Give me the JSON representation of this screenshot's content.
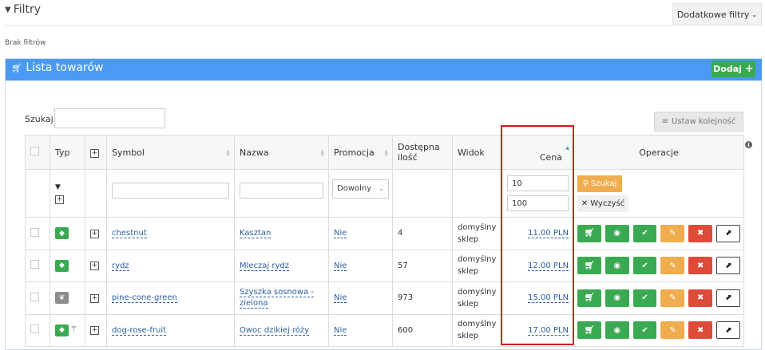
{
  "filters": {
    "title": "Filtry",
    "extra_label": "Dodatkowe filtry",
    "no_filters": "Brak filtrów"
  },
  "panel": {
    "title": "Lista towarów",
    "add_label": "Dodaj"
  },
  "search": {
    "label": "Szukaj:",
    "value": ""
  },
  "order_label": "Ustaw kolejność",
  "table": {
    "headers": {
      "typ": "Typ",
      "symbol": "Symbol",
      "nazwa": "Nazwa",
      "promocja": "Promocja",
      "ilosc_1": "Dostępna",
      "ilosc_2": "ilość",
      "widok": "Widok",
      "cena": "Cena",
      "operacje": "Operacje"
    },
    "filter": {
      "promocja": "Dowolny",
      "cena_min": "10",
      "cena_max": "100",
      "search_btn": "Szukaj",
      "clear_btn": "Wyczyść"
    },
    "rows": [
      {
        "symbol": "chestnut",
        "nazwa": "Kasztan",
        "promocja": "Nie",
        "ilosc": "4",
        "widok_1": "domyślny",
        "widok_2": "sklep",
        "cena": "11.00 PLN"
      },
      {
        "symbol": "rydz",
        "nazwa": "Mleczaj rydz",
        "promocja": "Nie",
        "ilosc": "57",
        "widok_1": "domyślny",
        "widok_2": "sklep",
        "cena": "12.00 PLN"
      },
      {
        "symbol": "pine-cone-green",
        "nazwa_1": "Szyszka sosnowa -",
        "nazwa_2": "zielona",
        "promocja": "Nie",
        "ilosc": "973",
        "widok_1": "domyślny",
        "widok_2": "sklep",
        "cena": "15.00 PLN"
      },
      {
        "symbol": "dog-rose-fruit",
        "nazwa": "Owoc dzikiej róży",
        "promocja": "Nie",
        "ilosc": "600",
        "widok_1": "domyślny",
        "widok_2": "sklep",
        "cena": "17.00 PLN"
      }
    ]
  },
  "colors": {
    "header_blue": "#4a9af5",
    "success": "#3aaa52",
    "warning": "#f0ad4e",
    "danger": "#dd4b39",
    "highlight": "#d9181e"
  },
  "icons": {
    "filter": "funnel-icon",
    "cart": "cart-icon",
    "plus": "plus-icon",
    "list": "list-icon",
    "info": "info-icon",
    "search": "search-icon",
    "close": "close-icon",
    "eye": "eye-icon",
    "check": "check-icon",
    "pencil": "pencil-icon",
    "external": "external-link-icon",
    "tag": "tag-icon",
    "leaf": "leaf-icon"
  }
}
